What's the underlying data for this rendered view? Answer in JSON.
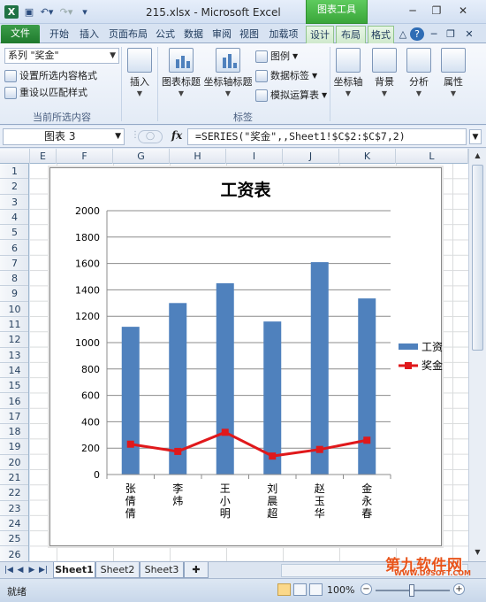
{
  "titlebar": {
    "filename": "215.xlsx",
    "separator": " - ",
    "app_name": "Microsoft Excel",
    "context_tab_group": "图表工具"
  },
  "tabs": [
    "文件",
    "开始",
    "插入",
    "页面布局",
    "公式",
    "数据",
    "审阅",
    "视图",
    "加载项",
    "设计",
    "布局",
    "格式"
  ],
  "active_tab": "布局",
  "ribbon": {
    "series_selector_value": "系列 \"奖金\"",
    "format_selection": "设置所选内容格式",
    "reset_match_style": "重设以匹配样式",
    "current_selection_group": "当前所选内容",
    "insert": "插入",
    "chart_title": "图表标题",
    "axis_titles": "坐标轴标题",
    "legend": "图例",
    "data_labels": "数据标签",
    "data_table": "模拟运算表",
    "labels_group": "标签",
    "axes": "坐标轴",
    "background": "背景",
    "analysis": "分析",
    "properties": "属性"
  },
  "formula_bar": {
    "name_box": "图表 3",
    "fx_label": "fx",
    "formula": "=SERIES(\"奖金\",,Sheet1!$C$2:$C$7,2)"
  },
  "columns": [
    "E",
    "F",
    "G",
    "H",
    "I",
    "J",
    "K",
    "L"
  ],
  "rows": [
    "1",
    "2",
    "3",
    "4",
    "5",
    "6",
    "7",
    "8",
    "9",
    "10",
    "11",
    "12",
    "13",
    "14",
    "15",
    "16",
    "17",
    "18",
    "19",
    "20",
    "21",
    "22",
    "23",
    "24",
    "25",
    "26"
  ],
  "chart_data": {
    "type": "bar",
    "title": "工资表",
    "categories": [
      "张倩倩",
      "李炜",
      "王小明",
      "刘晨超",
      "赵玉华",
      "金永春"
    ],
    "ylim": [
      0,
      2000
    ],
    "yticks": [
      0,
      200,
      400,
      600,
      800,
      1000,
      1200,
      1400,
      1600,
      1800,
      2000
    ],
    "grid": true,
    "legend_position": "right",
    "series": [
      {
        "name": "工资",
        "type": "bar",
        "color": "#4f81bd",
        "values": [
          1120,
          1300,
          1450,
          1160,
          1610,
          1335
        ]
      },
      {
        "name": "奖金",
        "type": "line",
        "color": "#e0181b",
        "values": [
          230,
          175,
          320,
          140,
          190,
          260
        ]
      }
    ]
  },
  "sheets": [
    "Sheet1",
    "Sheet2",
    "Sheet3"
  ],
  "active_sheet": "Sheet1",
  "status": {
    "ready": "就绪",
    "zoom": "100%"
  },
  "watermark": {
    "text": "第九软件网",
    "sub": "WWW.D9SOFT.COM"
  }
}
